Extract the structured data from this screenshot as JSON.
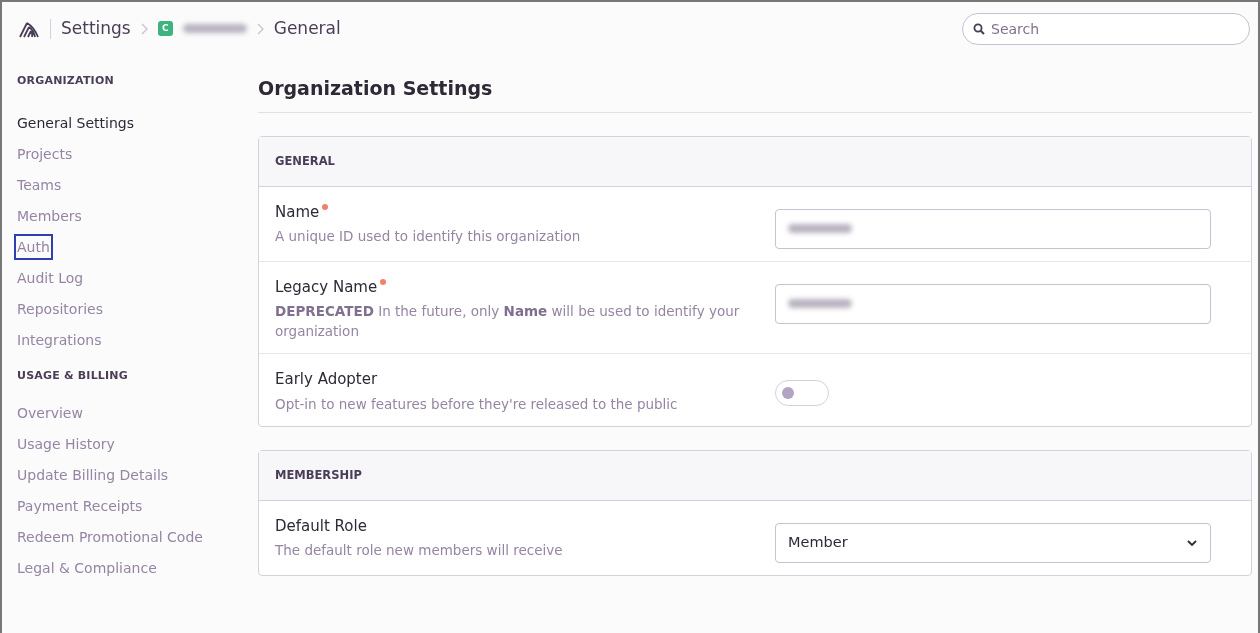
{
  "breadcrumb": {
    "root": "Settings",
    "org_initial": "C",
    "org_redacted": true,
    "current": "General"
  },
  "search": {
    "placeholder": "Search"
  },
  "sidebar": {
    "sections": [
      {
        "heading": "ORGANIZATION",
        "items": [
          {
            "label": "General Settings",
            "selected": true,
            "highlighted": false
          },
          {
            "label": "Projects",
            "selected": false,
            "highlighted": false
          },
          {
            "label": "Teams",
            "selected": false,
            "highlighted": false
          },
          {
            "label": "Members",
            "selected": false,
            "highlighted": false
          },
          {
            "label": "Auth",
            "selected": false,
            "highlighted": true
          },
          {
            "label": "Audit Log",
            "selected": false,
            "highlighted": false
          },
          {
            "label": "Repositories",
            "selected": false,
            "highlighted": false
          },
          {
            "label": "Integrations",
            "selected": false,
            "highlighted": false
          }
        ]
      },
      {
        "heading": "USAGE & BILLING",
        "items": [
          {
            "label": "Overview",
            "selected": false,
            "highlighted": false
          },
          {
            "label": "Usage History",
            "selected": false,
            "highlighted": false
          },
          {
            "label": "Update Billing Details",
            "selected": false,
            "highlighted": false
          },
          {
            "label": "Payment Receipts",
            "selected": false,
            "highlighted": false
          },
          {
            "label": "Redeem Promotional Code",
            "selected": false,
            "highlighted": false
          },
          {
            "label": "Legal & Compliance",
            "selected": false,
            "highlighted": false
          }
        ]
      }
    ]
  },
  "page_title": "Organization Settings",
  "panels": [
    {
      "header": "GENERAL",
      "fields": [
        {
          "kind": "text",
          "label": "Name",
          "required": true,
          "help": "A unique ID used to identify this organization",
          "redacted": true
        },
        {
          "kind": "text",
          "label": "Legacy Name",
          "required": true,
          "help": "**DEPRECATED** In the future, only **Name** will be used to identify your organization",
          "redacted": true
        },
        {
          "kind": "switch",
          "label": "Early Adopter",
          "required": false,
          "help": "Opt-in to new features before they're released to the public",
          "on": false
        }
      ]
    },
    {
      "header": "MEMBERSHIP",
      "fields": [
        {
          "kind": "select",
          "label": "Default Role",
          "required": false,
          "help": "The default role new members will receive",
          "value": "Member"
        }
      ]
    }
  ]
}
